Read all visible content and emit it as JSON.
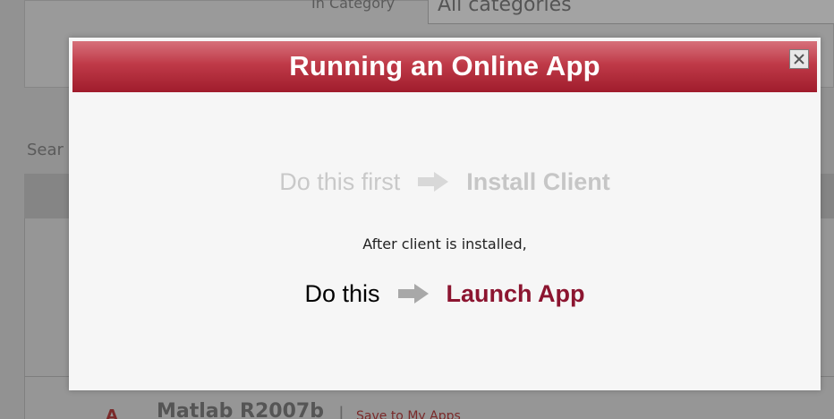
{
  "background": {
    "category_label": "In Category",
    "category_value": "All categories",
    "search_label": "Sear",
    "row": {
      "letter": "A",
      "title": "Matlab R2007b",
      "separator": "|",
      "link": "Save to My Apps"
    }
  },
  "modal": {
    "title": "Running an Online App",
    "close_icon": "close-icon",
    "install": {
      "prefix": "Do this first",
      "link": "Install Client"
    },
    "note": "After client is installed,",
    "launch": {
      "prefix": "Do this",
      "link": "Launch App"
    }
  },
  "colors": {
    "header_red": "#bf3a48",
    "launch_link": "#8c1530",
    "disabled_text": "#c9c9c9",
    "arrow_active": "#a8a8a8",
    "arrow_disabled": "#d8d8d8"
  }
}
